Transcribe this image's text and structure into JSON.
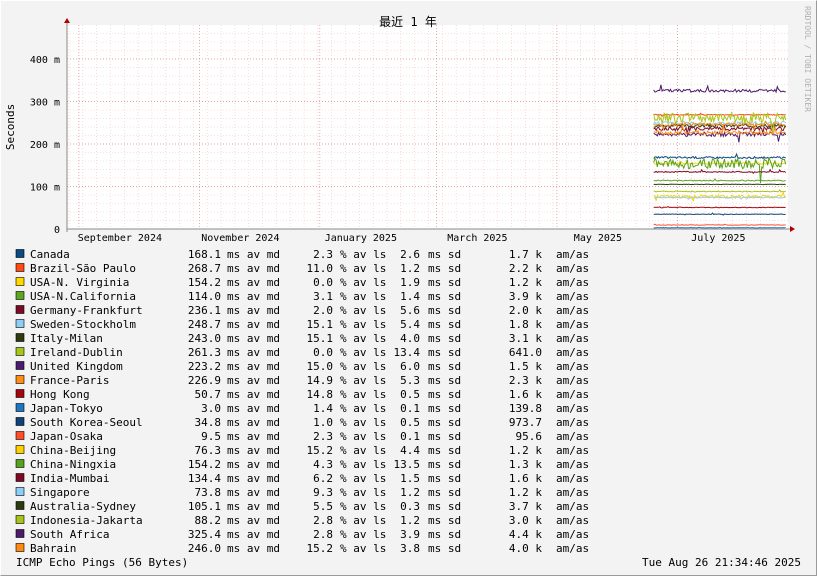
{
  "chart_data": {
    "type": "line",
    "title": "最近 1 年",
    "ylabel": "Seconds",
    "watermark": "RRDTOOL / TOBI OETIKER",
    "ylim": [
      0,
      0.48
    ],
    "y_ticks": [
      {
        "v": 0,
        "label": "0"
      },
      {
        "v": 0.1,
        "label": "100 m"
      },
      {
        "v": 0.2,
        "label": "200 m"
      },
      {
        "v": 0.3,
        "label": "300 m"
      },
      {
        "v": 0.4,
        "label": "400 m"
      }
    ],
    "x_start": "2024-08-26",
    "x_end": "2025-08-26",
    "x_ticks": [
      {
        "date": "2024-09-01",
        "label": "September 2024"
      },
      {
        "date": "2024-11-01",
        "label": "November 2024"
      },
      {
        "date": "2025-01-01",
        "label": "January 2025"
      },
      {
        "date": "2025-03-01",
        "label": "March 2025"
      },
      {
        "date": "2025-05-01",
        "label": "May 2025"
      },
      {
        "date": "2025-07-01",
        "label": "July 2025"
      }
    ],
    "data_start": "2025-06-19",
    "series": [
      {
        "name": "Canada",
        "color": "#0b4a82",
        "avg_ms": "168.1",
        "loss": "2.3",
        "sd": "2.6",
        "amas": "1.7 k"
      },
      {
        "name": "Brazil-São Paulo",
        "color": "#ff4a12",
        "avg_ms": "268.7",
        "loss": "11.0",
        "sd": "1.2",
        "amas": "2.2 k"
      },
      {
        "name": "USA-N. Virginia",
        "color": "#ffd800",
        "avg_ms": "154.2",
        "loss": "0.0",
        "sd": "1.9",
        "amas": "1.2 k"
      },
      {
        "name": "USA-N.California",
        "color": "#5da623",
        "avg_ms": "114.0",
        "loss": "3.1",
        "sd": "1.4",
        "amas": "3.9 k"
      },
      {
        "name": "Germany-Frankfurt",
        "color": "#7a0a2a",
        "avg_ms": "236.1",
        "loss": "2.0",
        "sd": "5.6",
        "amas": "2.0 k"
      },
      {
        "name": "Sweden-Stockholm",
        "color": "#8ecdf5",
        "avg_ms": "248.7",
        "loss": "15.1",
        "sd": "5.4",
        "amas": "1.8 k"
      },
      {
        "name": "Italy-Milan",
        "color": "#2e3a12",
        "avg_ms": "243.0",
        "loss": "15.1",
        "sd": "4.0",
        "amas": "3.1 k"
      },
      {
        "name": "Ireland-Dublin",
        "color": "#a6c61a",
        "avg_ms": "261.3",
        "loss": "0.0",
        "sd": "13.4",
        "amas": "641.0"
      },
      {
        "name": "United Kingdom",
        "color": "#4a1a6e",
        "avg_ms": "223.2",
        "loss": "15.0",
        "sd": "6.0",
        "amas": "1.5 k"
      },
      {
        "name": "France-Paris",
        "color": "#ff8c16",
        "avg_ms": "226.9",
        "loss": "14.9",
        "sd": "5.3",
        "amas": "2.3 k"
      },
      {
        "name": "Hong Kong",
        "color": "#a3060e",
        "avg_ms": "50.7",
        "loss": "14.8",
        "sd": "0.5",
        "amas": "1.6 k"
      },
      {
        "name": "Japan-Tokyo",
        "color": "#1c76c0",
        "avg_ms": "3.0",
        "loss": "1.4",
        "sd": "0.1",
        "amas": "139.8"
      },
      {
        "name": "South Korea-Seoul",
        "color": "#0e4378",
        "avg_ms": "34.8",
        "loss": "1.0",
        "sd": "0.5",
        "amas": "973.7"
      },
      {
        "name": "Japan-Osaka",
        "color": "#ff4f2a",
        "avg_ms": "9.5",
        "loss": "2.3",
        "sd": "0.1",
        "amas": "95.6"
      },
      {
        "name": "China-Beijing",
        "color": "#ffd000",
        "avg_ms": "76.3",
        "loss": "15.2",
        "sd": "4.4",
        "amas": "1.2 k"
      },
      {
        "name": "China-Ningxia",
        "color": "#55a21e",
        "avg_ms": "154.2",
        "loss": "4.3",
        "sd": "13.5",
        "amas": "1.3 k"
      },
      {
        "name": "India-Mumbai",
        "color": "#7b0a26",
        "avg_ms": "134.4",
        "loss": "6.2",
        "sd": "1.5",
        "amas": "1.6 k"
      },
      {
        "name": "Singapore",
        "color": "#8ccff7",
        "avg_ms": "73.8",
        "loss": "9.3",
        "sd": "1.2",
        "amas": "1.2 k"
      },
      {
        "name": "Australia-Sydney",
        "color": "#2b3a10",
        "avg_ms": "105.1",
        "loss": "5.5",
        "sd": "0.3",
        "amas": "3.7 k"
      },
      {
        "name": "Indonesia-Jakarta",
        "color": "#a8c418",
        "avg_ms": "88.2",
        "loss": "2.8",
        "sd": "1.2",
        "amas": "3.0 k"
      },
      {
        "name": "South Africa",
        "color": "#4c1a6a",
        "avg_ms": "325.4",
        "loss": "2.8",
        "sd": "3.9",
        "amas": "4.4 k"
      },
      {
        "name": "Bahrain",
        "color": "#ff8a10",
        "avg_ms": "246.0",
        "loss": "15.2",
        "sd": "3.8",
        "amas": "4.0 k"
      }
    ]
  },
  "legend_units": {
    "avg": "ms av md",
    "loss": "% av ls",
    "sd": "ms sd",
    "amas": "am/as"
  },
  "footer": {
    "left": "ICMP Echo Pings (56 Bytes)",
    "right": "Tue Aug 26 21:34:46 2025"
  }
}
